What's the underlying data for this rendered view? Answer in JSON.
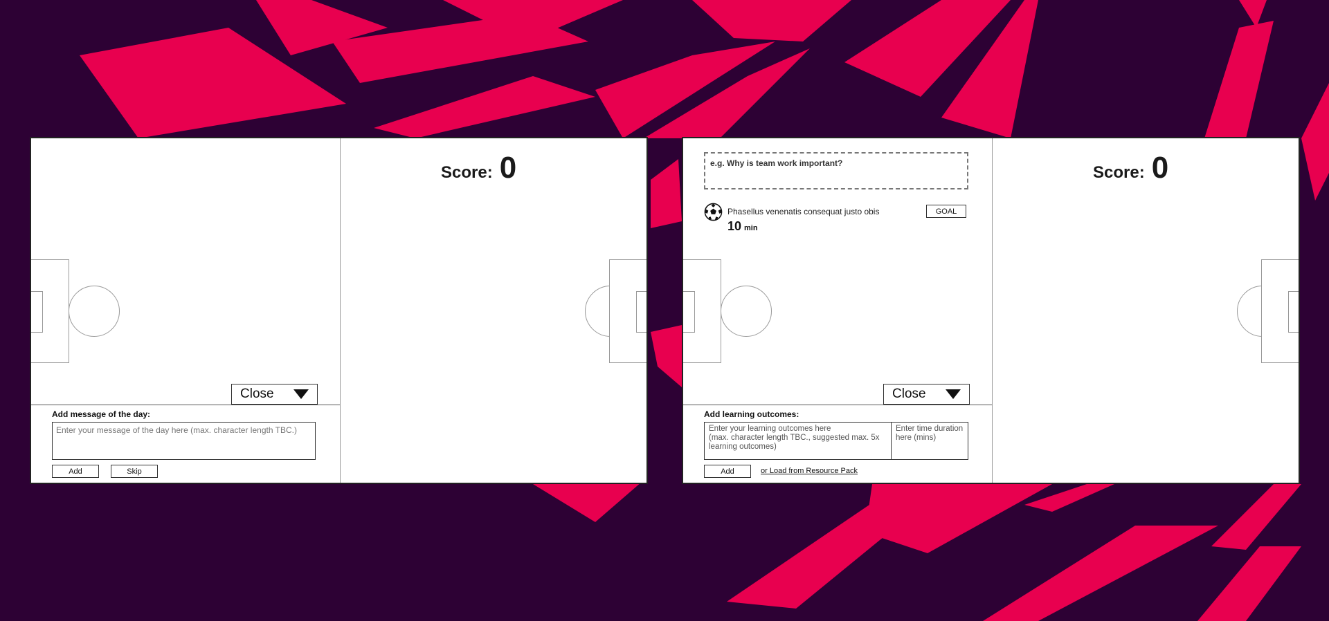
{
  "colors": {
    "background": "#2d0134",
    "accent": "#e8004f",
    "panel": "#ffffff"
  },
  "left_panel": {
    "score_label": "Score:",
    "score_value": "0",
    "close_label": "Close",
    "form_label": "Add message of the day:",
    "message_placeholder": "Enter your message of the day here (max. character length TBC.)",
    "add_label": "Add",
    "skip_label": "Skip"
  },
  "right_panel": {
    "score_label": "Score:",
    "score_value": "0",
    "question_placeholder": "e.g. Why is team work important?",
    "task": {
      "icon": "soccer-ball-icon",
      "text": "Phasellus venenatis consequat justo obis",
      "duration_value": "10",
      "duration_unit": "min",
      "goal_label": "GOAL"
    },
    "close_label": "Close",
    "form_label": "Add learning outcomes:",
    "outcomes_placeholder": "Enter your learning outcomes here\n(max. character length TBC., suggested max. 5x learning outcomes)",
    "time_placeholder": "Enter time duration here (mins)",
    "add_label": "Add",
    "load_link": "or Load from Resource Pack"
  }
}
